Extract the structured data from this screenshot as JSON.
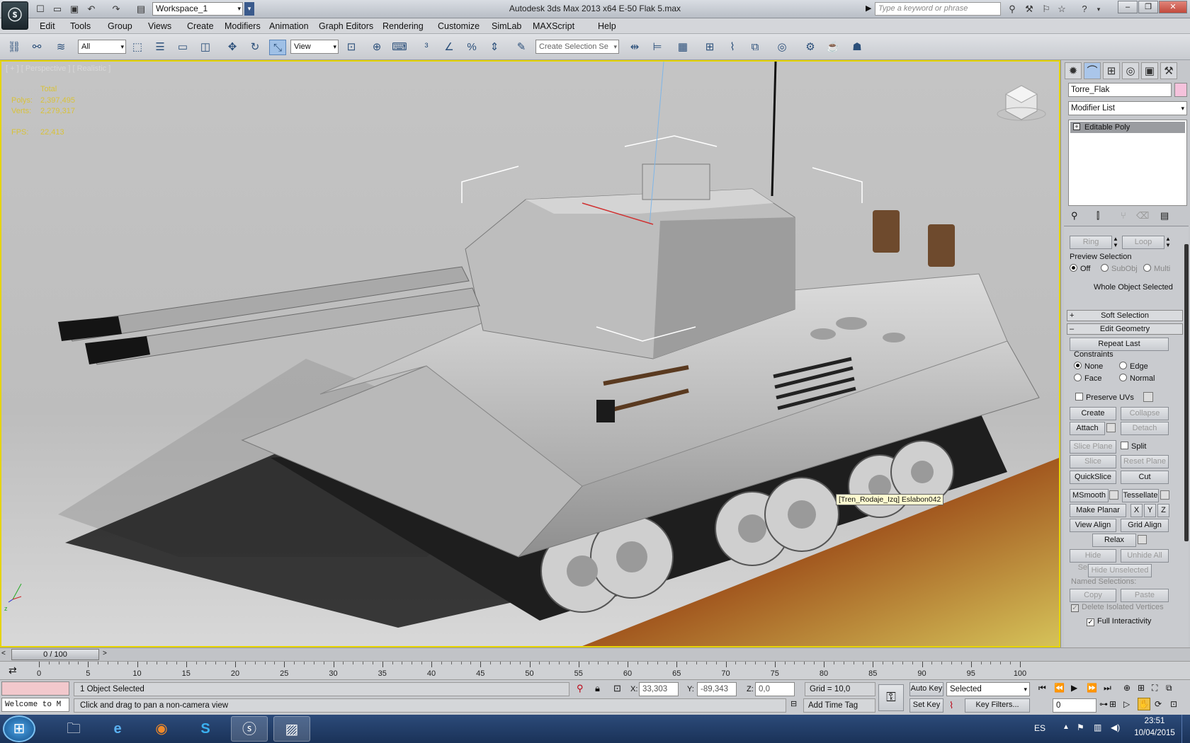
{
  "titlebar": {
    "workspace": "Workspace_1",
    "title": "Autodesk 3ds Max  2013 x64      E-50 Flak 5.max",
    "search_placeholder": "Type a keyword or phrase"
  },
  "menu": [
    "Edit",
    "Tools",
    "Group",
    "Views",
    "Create",
    "Modifiers",
    "Animation",
    "Graph Editors",
    "Rendering",
    "Customize",
    "SimLab",
    "MAXScript",
    "Help"
  ],
  "toolbar": {
    "filter": "All",
    "ref_coord": "View",
    "selection_set": "Create Selection Se"
  },
  "viewport": {
    "label": "[ + ] [ Perspective ] [ Realistic ]",
    "stats": {
      "header": "Total",
      "polys_label": "Polys:",
      "polys": "2,397,495",
      "verts_label": "Verts:",
      "verts": "2,279,317",
      "fps_label": "FPS:",
      "fps": "22,413"
    },
    "tooltip": "[Tren_Rodaje_Izq] Eslabon042"
  },
  "panel": {
    "object_name": "Torre_Flak",
    "modifier_list": "Modifier List",
    "stack_item": "Editable Poly",
    "ring": "Ring",
    "loop": "Loop",
    "preview_selection": "Preview Selection",
    "preview_opts": [
      "Off",
      "SubObj",
      "Multi"
    ],
    "whole_object": "Whole Object Selected",
    "soft_selection": "Soft Selection",
    "edit_geometry": "Edit Geometry",
    "repeat_last": "Repeat Last",
    "constraints": "Constraints",
    "constraint_opts": [
      "None",
      "Edge",
      "Face",
      "Normal"
    ],
    "preserve_uvs": "Preserve UVs",
    "create": "Create",
    "collapse": "Collapse",
    "attach": "Attach",
    "detach": "Detach",
    "slice_plane": "Slice Plane",
    "split": "Split",
    "slice": "Slice",
    "reset_plane": "Reset Plane",
    "quickslice": "QuickSlice",
    "cut": "Cut",
    "msmooth": "MSmooth",
    "tessellate": "Tessellate",
    "make_planar": "Make Planar",
    "x": "X",
    "y": "Y",
    "z": "Z",
    "view_align": "View Align",
    "grid_align": "Grid Align",
    "relax": "Relax",
    "hide_selected": "Hide Selected",
    "unhide_all": "Unhide All",
    "hide_unselected": "Hide Unselected",
    "named_selections": "Named Selections:",
    "copy": "Copy",
    "paste": "Paste",
    "delete_isolated": "Delete Isolated Vertices",
    "full_interactivity": "Full Interactivity"
  },
  "timeline": {
    "frame": "0 / 100",
    "ticks": [
      "0",
      "5",
      "10",
      "15",
      "20",
      "25",
      "30",
      "35",
      "40",
      "45",
      "50",
      "55",
      "60",
      "65",
      "70",
      "75",
      "80",
      "85",
      "90",
      "95",
      "100"
    ]
  },
  "status": {
    "selected": "1 Object Selected",
    "prompt": "Click and drag to pan a non-camera view",
    "listener": "Welcome to M",
    "x_label": "X:",
    "x": "33,303",
    "y_label": "Y:",
    "y": "-89,343",
    "z_label": "Z:",
    "z": "0,0",
    "grid": "Grid = 10,0",
    "add_time_tag": "Add Time Tag",
    "auto_key": "Auto Key",
    "set_key": "Set Key",
    "key_mode": "Selected",
    "key_filters": "Key Filters...",
    "frame_field": "0"
  },
  "taskbar": {
    "lang": "ES",
    "time": "23:51",
    "date": "10/04/2015"
  }
}
